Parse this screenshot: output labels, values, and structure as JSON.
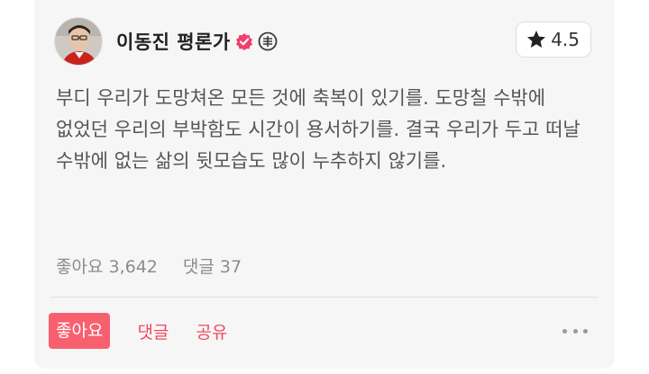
{
  "author": {
    "name": "이동진 평론가",
    "avatar_icon": "user-avatar",
    "verified_icon": "verified-badge-icon",
    "verified_color": "#f03f6b",
    "critic_icon": "critic-logo-icon"
  },
  "rating": {
    "icon": "star-icon",
    "value": "4.5"
  },
  "comment": {
    "text": "부디 우리가 도망쳐온 모든 것에 축복이 있기를. 도망칠 수밖에 없었던 우리의 부박함도 시간이 용서하기를. 결국 우리가 두고 떠날 수밖에 없는 삶의 뒷모습도 많이 누추하지 않기를."
  },
  "stats": {
    "likes": "좋아요 3,642",
    "comments": "댓글 37"
  },
  "actions": {
    "like_label": "좋아요",
    "comment_label": "댓글",
    "share_label": "공유",
    "more_icon": "more-horizontal-icon"
  },
  "colors": {
    "accent": "#f8606f",
    "accent_text": "#f04a5e",
    "card_bg": "#f6f6f7"
  }
}
